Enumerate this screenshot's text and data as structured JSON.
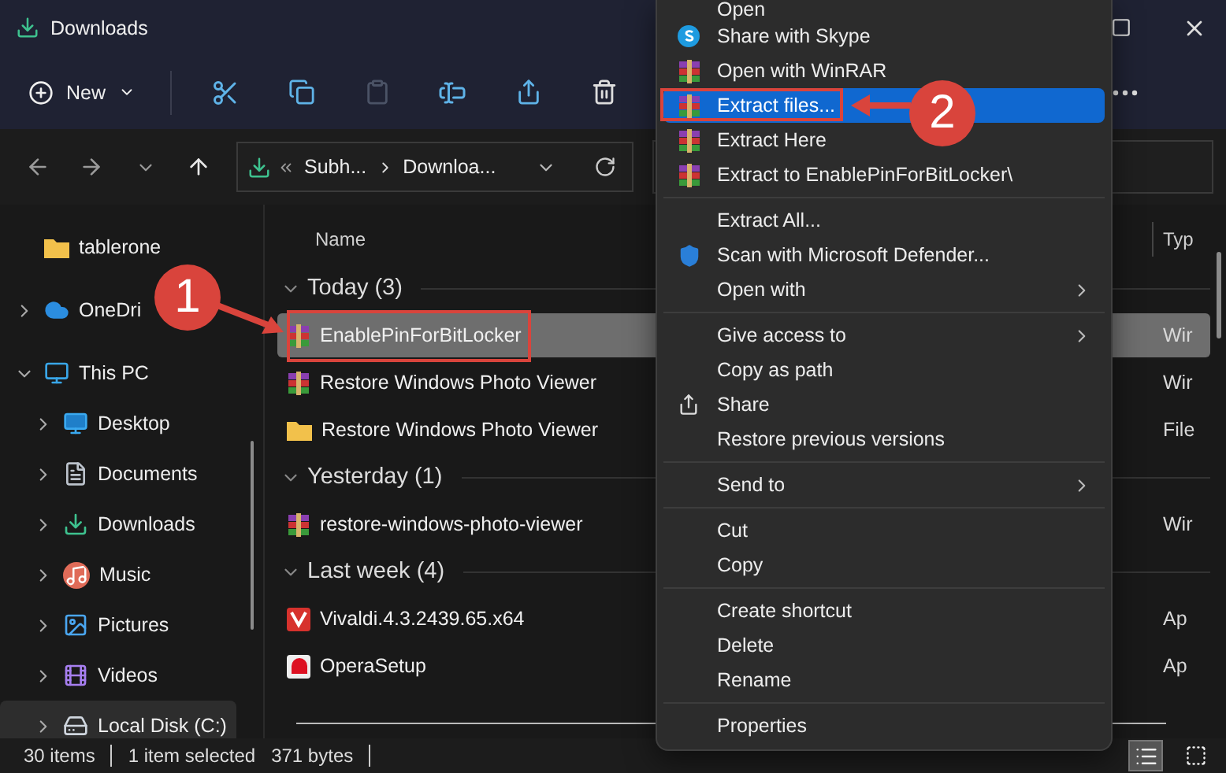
{
  "window": {
    "title": "Downloads"
  },
  "toolbar": {
    "new_label": "New"
  },
  "address_bar": {
    "path": [
      "Subh...",
      "Downloa..."
    ]
  },
  "sidebar": {
    "items": [
      {
        "label": "tablerone",
        "kind": "folder",
        "selected": false
      },
      {
        "label": "OneDri",
        "kind": "cloud",
        "expanded": false,
        "selected": false
      },
      {
        "label": "This PC",
        "kind": "pc",
        "expanded": true,
        "selected": false,
        "children": [
          {
            "label": "Desktop",
            "kind": "desktop",
            "expanded": false,
            "selected": false
          },
          {
            "label": "Documents",
            "kind": "documents",
            "expanded": false,
            "selected": false
          },
          {
            "label": "Downloads",
            "kind": "downloads",
            "expanded": false,
            "selected": false
          },
          {
            "label": "Music",
            "kind": "music",
            "expanded": false,
            "selected": false
          },
          {
            "label": "Pictures",
            "kind": "pictures",
            "expanded": false,
            "selected": false
          },
          {
            "label": "Videos",
            "kind": "videos",
            "expanded": false,
            "selected": false
          },
          {
            "label": "Local Disk (C:)",
            "kind": "disk",
            "expanded": false,
            "selected": true
          }
        ]
      }
    ]
  },
  "file_list": {
    "columns": [
      "Name",
      "Typ"
    ],
    "groups": [
      {
        "title": "Today (3)",
        "expanded": true,
        "items": [
          {
            "name": "EnablePinForBitLocker",
            "kind": "archive",
            "type": "Wir",
            "selected": true
          },
          {
            "name": "Restore Windows Photo Viewer",
            "kind": "archive",
            "type": "Wir",
            "selected": false
          },
          {
            "name": "Restore Windows Photo Viewer",
            "kind": "folder",
            "type": "File",
            "selected": false
          }
        ]
      },
      {
        "title": "Yesterday (1)",
        "expanded": true,
        "items": [
          {
            "name": "restore-windows-photo-viewer",
            "kind": "archive",
            "type": "Wir",
            "selected": false
          }
        ]
      },
      {
        "title": "Last week (4)",
        "expanded": true,
        "items": [
          {
            "name": "Vivaldi.4.3.2439.65.x64",
            "kind": "vivaldi",
            "type": "Ap",
            "selected": false
          },
          {
            "name": "OperaSetup",
            "kind": "opera",
            "type": "Ap",
            "selected": false
          }
        ]
      }
    ]
  },
  "context_menu": {
    "items": [
      {
        "kind": "plain",
        "label": "Open",
        "selected": false
      },
      {
        "kind": "skype",
        "label": "Share with Skype",
        "selected": false
      },
      {
        "kind": "archive",
        "label": "Open with WinRAR",
        "selected": false
      },
      {
        "kind": "archive",
        "label": "Extract files...",
        "selected": true
      },
      {
        "kind": "archive",
        "label": "Extract Here",
        "selected": false
      },
      {
        "kind": "archive",
        "label": "Extract to EnablePinForBitLocker\\",
        "selected": false
      },
      {
        "kind": "separator"
      },
      {
        "kind": "plain",
        "label": "Extract All...",
        "selected": false
      },
      {
        "kind": "shield",
        "label": "Scan with Microsoft Defender...",
        "selected": false
      },
      {
        "kind": "submenu",
        "label": "Open with",
        "selected": false
      },
      {
        "kind": "separator"
      },
      {
        "kind": "submenu",
        "label": "Give access to",
        "selected": false
      },
      {
        "kind": "plain",
        "label": "Copy as path",
        "selected": false
      },
      {
        "kind": "share",
        "label": "Share",
        "selected": false
      },
      {
        "kind": "plain",
        "label": "Restore previous versions",
        "selected": false
      },
      {
        "kind": "separator"
      },
      {
        "kind": "submenu",
        "label": "Send to",
        "selected": false
      },
      {
        "kind": "separator"
      },
      {
        "kind": "plain",
        "label": "Cut",
        "selected": false
      },
      {
        "kind": "plain",
        "label": "Copy",
        "selected": false
      },
      {
        "kind": "separator"
      },
      {
        "kind": "plain",
        "label": "Create shortcut",
        "selected": false
      },
      {
        "kind": "plain",
        "label": "Delete",
        "selected": false
      },
      {
        "kind": "plain",
        "label": "Rename",
        "selected": false
      },
      {
        "kind": "separator"
      },
      {
        "kind": "plain",
        "label": "Properties",
        "selected": false
      }
    ]
  },
  "annotations": [
    {
      "label": "1"
    },
    {
      "label": "2"
    }
  ],
  "status_bar": {
    "count": "30 items",
    "selection": "1 item selected",
    "size": "371 bytes"
  },
  "view_buttons": [
    {
      "kind": "details",
      "selected": true
    },
    {
      "kind": "tiles",
      "selected": false
    }
  ]
}
